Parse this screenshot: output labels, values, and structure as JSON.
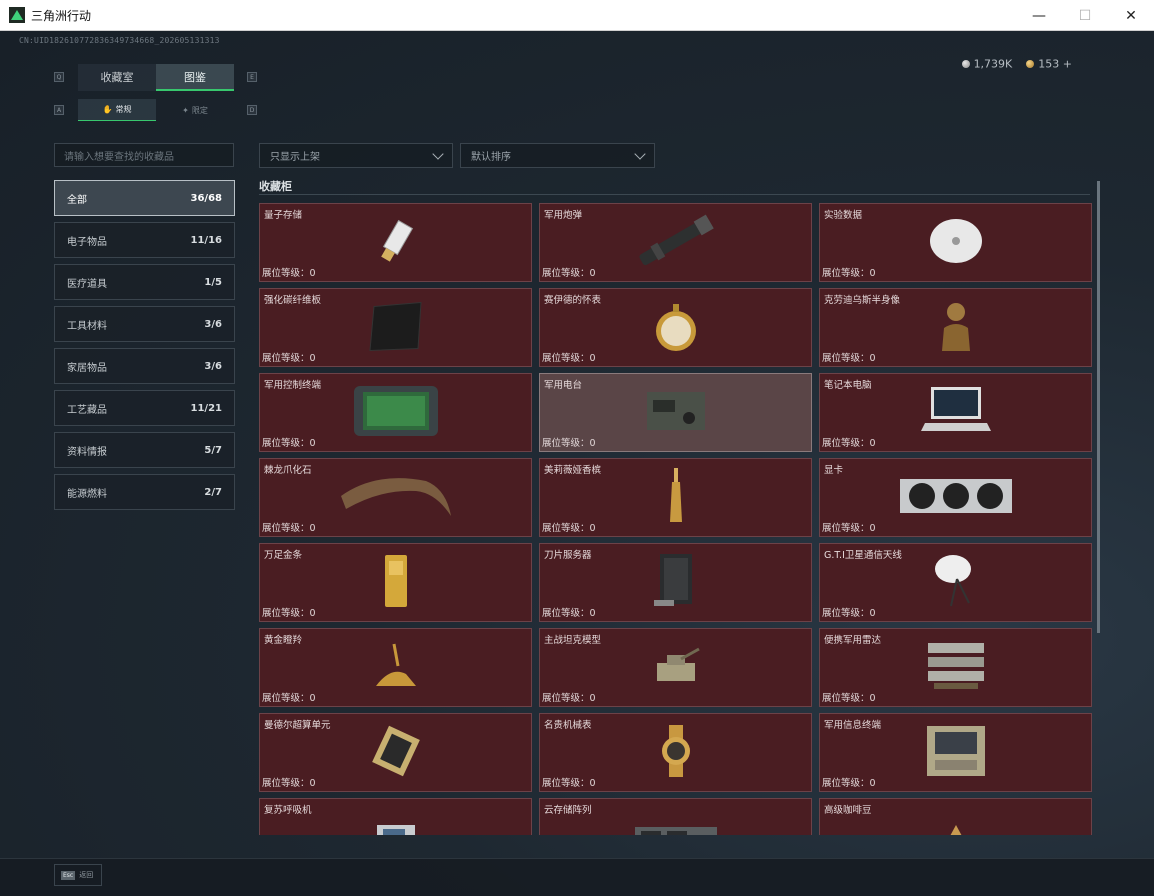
{
  "window": {
    "title": "三角洲行动",
    "controls": [
      "—",
      "☐",
      "✕"
    ]
  },
  "header": {
    "uid": "CN:UID182610772836349734668_202605131313",
    "currency": [
      {
        "icon": "silver-coin-icon",
        "value": "1,739K"
      },
      {
        "icon": "gold-coin-icon",
        "value": "153 +"
      }
    ]
  },
  "tabs": {
    "main": [
      {
        "label": "收藏室",
        "active": false
      },
      {
        "label": "图鉴",
        "active": true
      }
    ],
    "sub": [
      {
        "label": "常规",
        "active": true
      },
      {
        "label": "限定",
        "active": false
      }
    ],
    "keyhints": [
      "Q",
      "E",
      "A",
      "D"
    ]
  },
  "search": {
    "placeholder": "请输入想要查找的收藏品"
  },
  "categories": [
    {
      "label": "全部",
      "count": "36/68",
      "active": true
    },
    {
      "label": "电子物品",
      "count": "11/16"
    },
    {
      "label": "医疗道具",
      "count": "1/5"
    },
    {
      "label": "工具材料",
      "count": "3/6"
    },
    {
      "label": "家居物品",
      "count": "3/6"
    },
    {
      "label": "工艺藏品",
      "count": "11/21"
    },
    {
      "label": "资料情报",
      "count": "5/7"
    },
    {
      "label": "能源燃料",
      "count": "2/7"
    }
  ],
  "filters": {
    "shelf": "只显示上架",
    "sort": "默认排序"
  },
  "section_title": "收藏柜",
  "level_label": "展位等级：",
  "items": [
    {
      "name": "量子存储",
      "level": "0",
      "icon": "usb-drive-icon"
    },
    {
      "name": "军用炮弹",
      "level": "0",
      "icon": "artillery-shell-icon"
    },
    {
      "name": "实验数据",
      "level": "0",
      "icon": "disc-icon"
    },
    {
      "name": "强化碳纤维板",
      "level": "0",
      "icon": "carbon-plate-icon"
    },
    {
      "name": "赛伊德的怀表",
      "level": "0",
      "icon": "pocket-watch-icon"
    },
    {
      "name": "克劳迪乌斯半身像",
      "level": "0",
      "icon": "bust-icon"
    },
    {
      "name": "军用控制终端",
      "level": "0",
      "icon": "control-terminal-icon"
    },
    {
      "name": "军用电台",
      "level": "0",
      "icon": "military-radio-icon",
      "highlight": true
    },
    {
      "name": "笔记本电脑",
      "level": "0",
      "icon": "laptop-icon"
    },
    {
      "name": "棘龙爪化石",
      "level": "0",
      "icon": "claw-fossil-icon"
    },
    {
      "name": "美莉薇娅香槟",
      "level": "0",
      "icon": "champagne-icon"
    },
    {
      "name": "显卡",
      "level": "0",
      "icon": "graphics-card-icon"
    },
    {
      "name": "万足金条",
      "level": "0",
      "icon": "gold-bar-icon"
    },
    {
      "name": "刀片服务器",
      "level": "0",
      "icon": "server-icon"
    },
    {
      "name": "G.T.I卫星通信天线",
      "level": "0",
      "icon": "satellite-dish-icon"
    },
    {
      "name": "黄金瞪羚",
      "level": "0",
      "icon": "gold-gazelle-icon"
    },
    {
      "name": "主战坦克模型",
      "level": "0",
      "icon": "tank-model-icon"
    },
    {
      "name": "便携军用雷达",
      "level": "0",
      "icon": "radar-icon"
    },
    {
      "name": "曼德尔超算单元",
      "level": "0",
      "icon": "cpu-icon"
    },
    {
      "name": "名贵机械表",
      "level": "0",
      "icon": "wristwatch-icon"
    },
    {
      "name": "军用信息终端",
      "level": "0",
      "icon": "info-terminal-icon"
    },
    {
      "name": "复苏呼吸机",
      "level": "",
      "icon": "ventilator-icon"
    },
    {
      "name": "云存储阵列",
      "level": "",
      "icon": "storage-array-icon"
    },
    {
      "name": "高级咖啡豆",
      "level": "",
      "icon": "coffee-beans-icon"
    }
  ],
  "footer": {
    "esc": "Esc",
    "back": "返回"
  }
}
